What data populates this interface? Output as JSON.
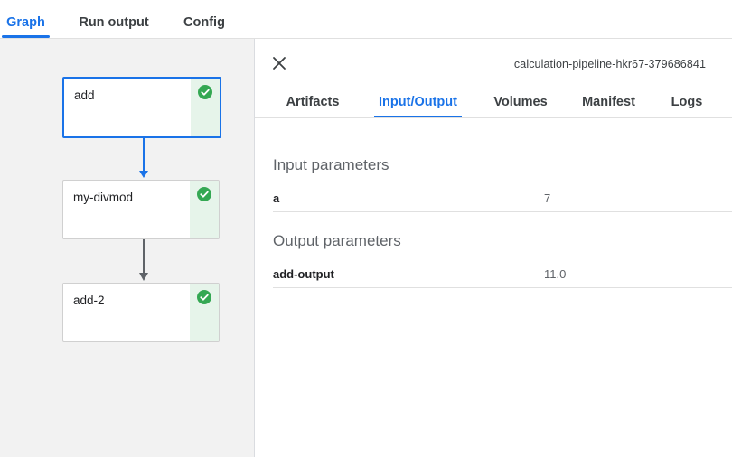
{
  "top_tabs": [
    {
      "label": "Graph",
      "active": true
    },
    {
      "label": "Run output",
      "active": false
    },
    {
      "label": "Config",
      "active": false
    }
  ],
  "graph": {
    "nodes": [
      {
        "label": "add",
        "status": "succeeded",
        "selected": true
      },
      {
        "label": "my-divmod",
        "status": "succeeded",
        "selected": false
      },
      {
        "label": "add-2",
        "status": "succeeded",
        "selected": false
      }
    ]
  },
  "details": {
    "run_id": "calculation-pipeline-hkr67-379686841",
    "tabs": [
      {
        "label": "Artifacts",
        "active": false
      },
      {
        "label": "Input/Output",
        "active": true
      },
      {
        "label": "Volumes",
        "active": false
      },
      {
        "label": "Manifest",
        "active": false
      },
      {
        "label": "Logs",
        "active": false
      }
    ],
    "input_title": "Input parameters",
    "inputs": [
      {
        "name": "a",
        "value": "7"
      }
    ],
    "output_title": "Output parameters",
    "outputs": [
      {
        "name": "add-output",
        "value": "11.0"
      }
    ]
  },
  "colors": {
    "accent": "#1a73e8",
    "success": "#34a853",
    "success_bg": "#e6f4ea"
  },
  "icons": {
    "close": "close-icon",
    "status": "check-circle-icon"
  }
}
